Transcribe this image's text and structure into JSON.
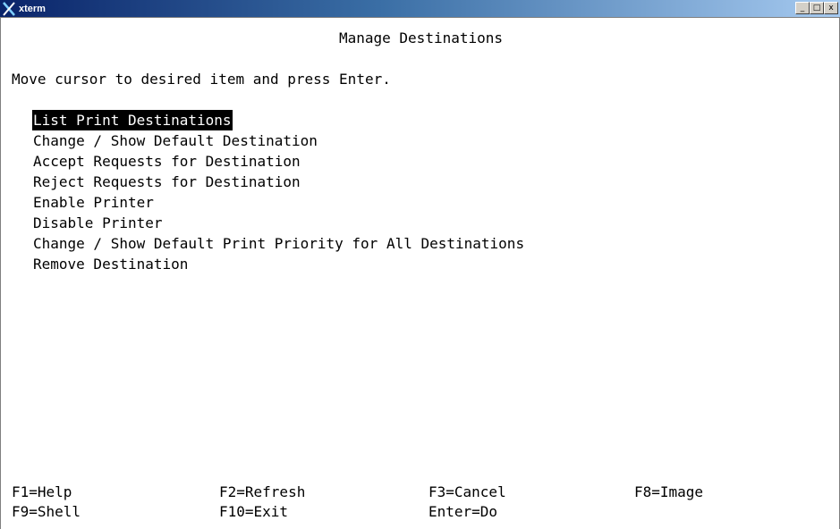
{
  "window": {
    "title": "xterm",
    "icon": "x-icon",
    "controls": {
      "minimize": "_",
      "maximize": "□",
      "close": "x"
    }
  },
  "screen": {
    "title": "Manage Destinations",
    "prompt": "Move cursor to desired item and press Enter."
  },
  "menu": {
    "selected_index": 0,
    "items": [
      "List Print Destinations",
      "Change / Show Default Destination",
      "Accept Requests for Destination",
      "Reject Requests for Destination",
      "Enable Printer",
      "Disable Printer",
      "Change / Show Default Print Priority for All Destinations",
      "Remove Destination"
    ]
  },
  "function_keys": {
    "row1": [
      "F1=Help",
      "F2=Refresh",
      "F3=Cancel",
      "F8=Image"
    ],
    "row2": [
      "F9=Shell",
      "F10=Exit",
      "Enter=Do"
    ]
  },
  "colors": {
    "terminal_bg": "#ffffff",
    "terminal_fg": "#000000",
    "selection_bg": "#000000",
    "selection_fg": "#ffffff",
    "titlebar_start": "#0a246a",
    "titlebar_end": "#a6caf0"
  }
}
